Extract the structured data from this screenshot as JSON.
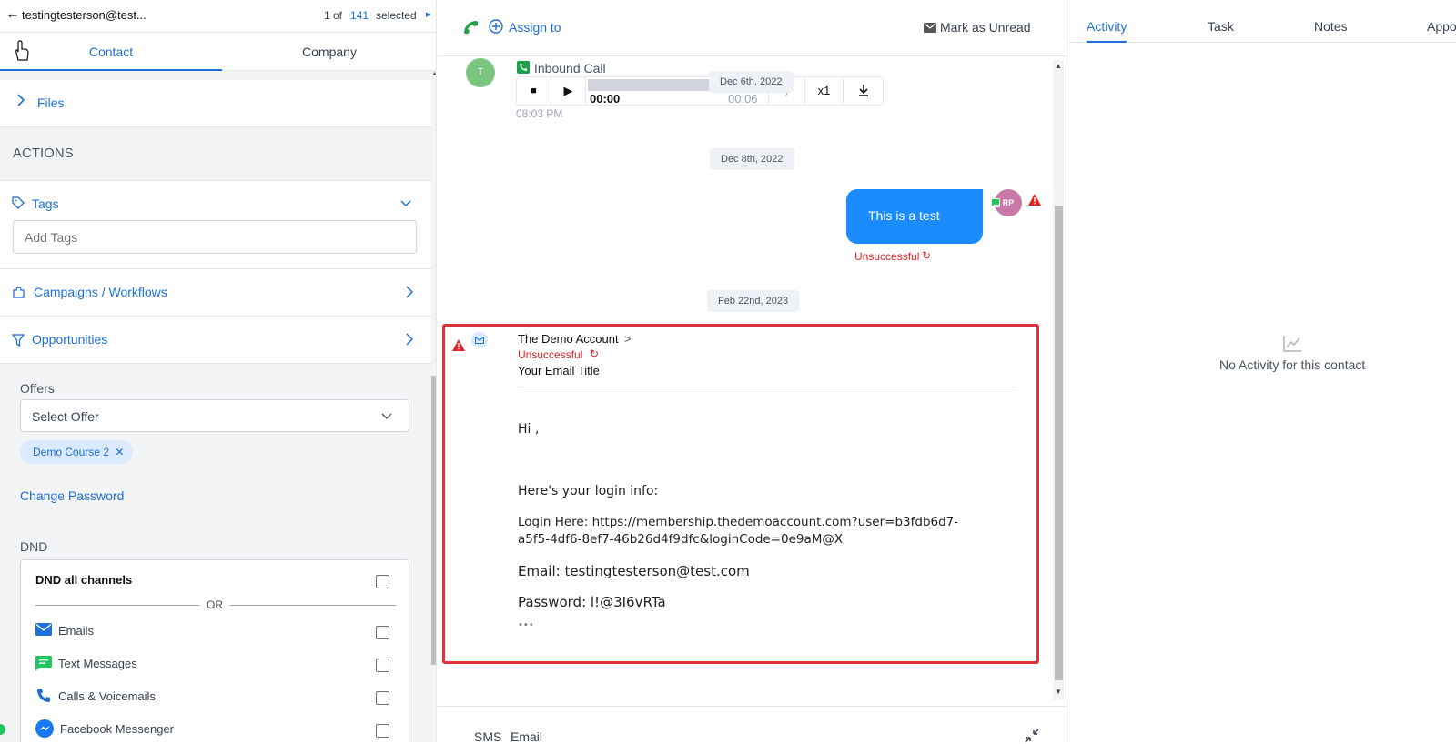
{
  "left": {
    "top_bar": {
      "email": "testingtesterson@test...",
      "of_label": "1 of",
      "count": "141",
      "selected_label": "selected"
    },
    "tabs": {
      "contact": "Contact",
      "company": "Company"
    },
    "files_label": "Files",
    "actions_header": "ACTIONS",
    "tags": {
      "label": "Tags",
      "placeholder": "Add Tags"
    },
    "campaigns_label": "Campaigns / Workflows",
    "opportunities_label": "Opportunities",
    "offers": {
      "label": "Offers",
      "select_value": "Select Offer",
      "chip": "Demo Course 2"
    },
    "change_password": "Change Password",
    "dnd": {
      "label": "DND",
      "all_channels": "DND all channels",
      "or": "OR",
      "channels": [
        "Emails",
        "Text Messages",
        "Calls & Voicemails",
        "Facebook Messenger"
      ]
    }
  },
  "middle": {
    "assign_to": "Assign to",
    "mark_unread": "Mark as Unread",
    "call": {
      "avatar": "T",
      "title": "Inbound Call",
      "time_start": "00:00",
      "time_end": "00:06",
      "speed": "x1",
      "date_pill": "Dec 6th, 2022",
      "timestamp": "08:03 PM"
    },
    "date2": "Dec 8th, 2022",
    "sms": {
      "text": "This is a test",
      "avatar": "RP",
      "status": "Unsuccessful"
    },
    "date3": "Feb 22nd, 2023",
    "email": {
      "from": "The Demo Account",
      "arrow": ">",
      "status": "Unsuccessful",
      "subject": "Your Email Title",
      "greeting": "Hi ,",
      "line1": "Here's your login info:",
      "login_line1": "Login Here: https://membership.thedemoaccount.com?user=b3fdb6d7-",
      "login_line2": "a5f5-4df6-8ef7-46b26d4f9dfc&loginCode=0e9aM@X",
      "email_line": "Email: testingtesterson@test.com",
      "password_line": "Password: l!@3I6vRTa",
      "more": "•••"
    },
    "composer_tabs": [
      "SMS",
      "Email"
    ]
  },
  "right": {
    "tabs": [
      "Activity",
      "Task",
      "Notes",
      "Appo"
    ],
    "empty": "No Activity for this contact"
  },
  "colors": {
    "brand_blue": "#1e6fd9",
    "sms_bubble": "#1a8cff",
    "error_red": "#dc2626",
    "highlight_border": "#e0323a",
    "avatar_green": "#7bc47f",
    "avatar_pink": "#c979a8"
  }
}
